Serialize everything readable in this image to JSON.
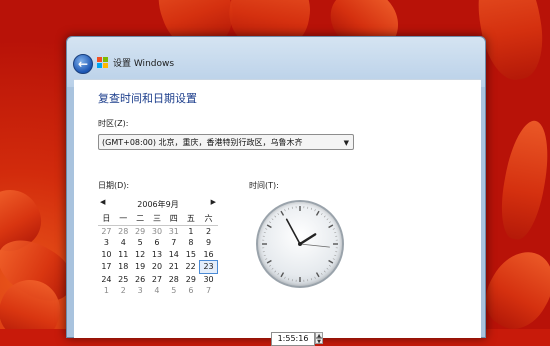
{
  "window": {
    "title": "设置 Windows",
    "back_icon": "back-arrow-icon",
    "logo_icon": "windows-logo-icon"
  },
  "page": {
    "heading": "复查时间和日期设置",
    "timezone_label": "时区(Z):",
    "timezone_value": "(GMT+08:00) 北京，重庆，香港特别行政区，乌鲁木齐",
    "date_label": "日期(D):",
    "time_label": "时间(T):"
  },
  "calendar": {
    "month_title": "2006年9月",
    "weekdays": [
      "日",
      "一",
      "二",
      "三",
      "四",
      "五",
      "六"
    ],
    "weeks": [
      [
        "27",
        "28",
        "29",
        "30",
        "31",
        "1",
        "2"
      ],
      [
        "3",
        "4",
        "5",
        "6",
        "7",
        "8",
        "9"
      ],
      [
        "10",
        "11",
        "12",
        "13",
        "14",
        "15",
        "16"
      ],
      [
        "17",
        "18",
        "19",
        "20",
        "21",
        "22",
        "23"
      ],
      [
        "24",
        "25",
        "26",
        "27",
        "28",
        "29",
        "30"
      ],
      [
        "1",
        "2",
        "3",
        "4",
        "5",
        "6",
        "7"
      ]
    ],
    "selected_day": "23"
  },
  "clock": {
    "time_value": "1:55:16",
    "hours": 1,
    "minutes": 55,
    "seconds": 16
  },
  "colors": {
    "heading": "#1c3e8c",
    "selection": "#4b8bd6"
  }
}
